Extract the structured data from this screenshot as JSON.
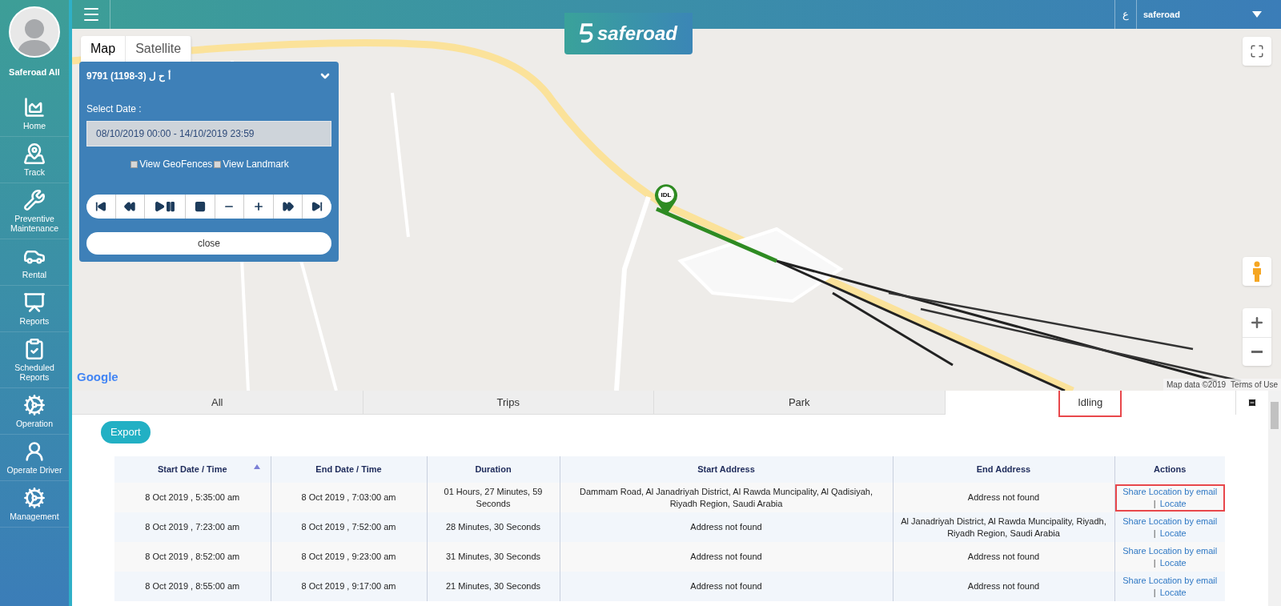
{
  "sidebar": {
    "user_name": "Saferoad All",
    "items": [
      {
        "label": "Home"
      },
      {
        "label": "Track"
      },
      {
        "label": "Preventive Maintenance"
      },
      {
        "label": "Rental"
      },
      {
        "label": "Reports"
      },
      {
        "label": "Scheduled Reports"
      },
      {
        "label": "Operation"
      },
      {
        "label": "Operate Driver"
      },
      {
        "label": "Management"
      }
    ]
  },
  "top_bar": {
    "logo": "saferoad",
    "language": "ع",
    "user": "saferoad"
  },
  "map": {
    "type_tabs": [
      {
        "label": "Map",
        "selected": true
      },
      {
        "label": "Satellite",
        "selected": false
      }
    ],
    "marker": "IDL",
    "attribution": "Google",
    "map_data": "Map data ©2019",
    "terms": "Terms of Use"
  },
  "playback_panel": {
    "vehicle": "9791 (1198-3) أ ح ل",
    "date_label": "Select Date :",
    "date_range": "08/10/2019 00:00 - 14/10/2019 23:59",
    "options": [
      {
        "label": "View GeoFences",
        "checked": false
      },
      {
        "label": "View Landmark",
        "checked": false
      }
    ],
    "controls": [
      {
        "kind": "first"
      },
      {
        "kind": "rewind"
      },
      {
        "kind": "playpause"
      },
      {
        "kind": "stop"
      },
      {
        "kind": "minus"
      },
      {
        "kind": "plus"
      },
      {
        "kind": "forward"
      },
      {
        "kind": "last"
      }
    ],
    "close": "close"
  },
  "tabs": [
    {
      "label": "All",
      "selected": false,
      "highlighted": false
    },
    {
      "label": "Trips",
      "selected": false,
      "highlighted": false
    },
    {
      "label": "Park",
      "selected": false,
      "highlighted": false
    },
    {
      "label": "Idling",
      "selected": true,
      "highlighted": true
    }
  ],
  "export": "Export",
  "table": {
    "columns": [
      {
        "label": "Start Date / Time",
        "sorted": true
      },
      {
        "label": "End Date / Time",
        "sorted": false
      },
      {
        "label": "Duration",
        "sorted": false
      },
      {
        "label": "Start Address",
        "sorted": false
      },
      {
        "label": "End Address",
        "sorted": false
      },
      {
        "label": "Actions",
        "sorted": false
      }
    ],
    "rows": [
      {
        "cells": [
          "8 Oct 2019 , 5:35:00 am",
          "8 Oct 2019 , 7:03:00 am",
          "01 Hours, 27 Minutes, 59 Seconds",
          "Dammam Road, Al Janadriyah District, Al Rawda Muncipality, Al Qadisiyah, Riyadh Region, Saudi Arabia",
          "Address not found"
        ],
        "actions": [
          "Share Location by email",
          "|",
          "Locate"
        ],
        "highlighted": true
      },
      {
        "cells": [
          "8 Oct 2019 , 7:23:00 am",
          "8 Oct 2019 , 7:52:00 am",
          "28 Minutes, 30 Seconds",
          "Address not found",
          "Al Janadriyah District, Al Rawda Muncipality, Riyadh, Riyadh Region, Saudi Arabia"
        ],
        "actions": [
          "Share Location by email",
          "|",
          "Locate"
        ],
        "highlighted": false
      },
      {
        "cells": [
          "8 Oct 2019 , 8:52:00 am",
          "8 Oct 2019 , 9:23:00 am",
          "31 Minutes, 30 Seconds",
          "Address not found",
          "Address not found"
        ],
        "actions": [
          "Share Location by email",
          "|",
          "Locate"
        ],
        "highlighted": false
      },
      {
        "cells": [
          "8 Oct 2019 , 8:55:00 am",
          "8 Oct 2019 , 9:17:00 am",
          "21 Minutes, 30 Seconds",
          "Address not found",
          "Address not found"
        ],
        "actions": [
          "Share Location by email",
          "|",
          "Locate"
        ],
        "highlighted": false
      }
    ]
  }
}
